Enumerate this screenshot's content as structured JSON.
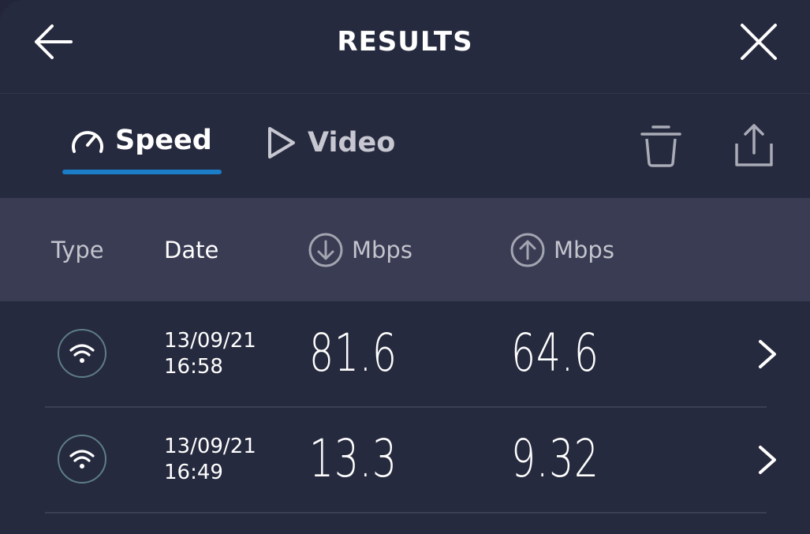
{
  "header": {
    "title": "RESULTS",
    "back_icon": "arrow-left-icon",
    "close_icon": "close-icon"
  },
  "tabs": [
    {
      "label": "Speed",
      "icon": "speedometer-icon",
      "active": true
    },
    {
      "label": "Video",
      "icon": "play-icon",
      "active": false
    }
  ],
  "toolbar": {
    "delete_icon": "trash-icon",
    "share_icon": "share-icon"
  },
  "columns": {
    "type": "Type",
    "date": "Date",
    "download": "Mbps",
    "upload": "Mbps",
    "download_icon": "download-arrow-icon",
    "upload_icon": "upload-arrow-icon"
  },
  "rows": [
    {
      "connection_icon": "wifi-icon",
      "date": "13/09/21",
      "time": "16:58",
      "download": "81.6",
      "upload": "64.6"
    },
    {
      "connection_icon": "wifi-icon",
      "date": "13/09/21",
      "time": "16:49",
      "download": "13.3",
      "upload": "9.32"
    }
  ],
  "colors": {
    "background": "#262a3e",
    "header_band": "#393c53",
    "accent": "#1b7cc8"
  }
}
